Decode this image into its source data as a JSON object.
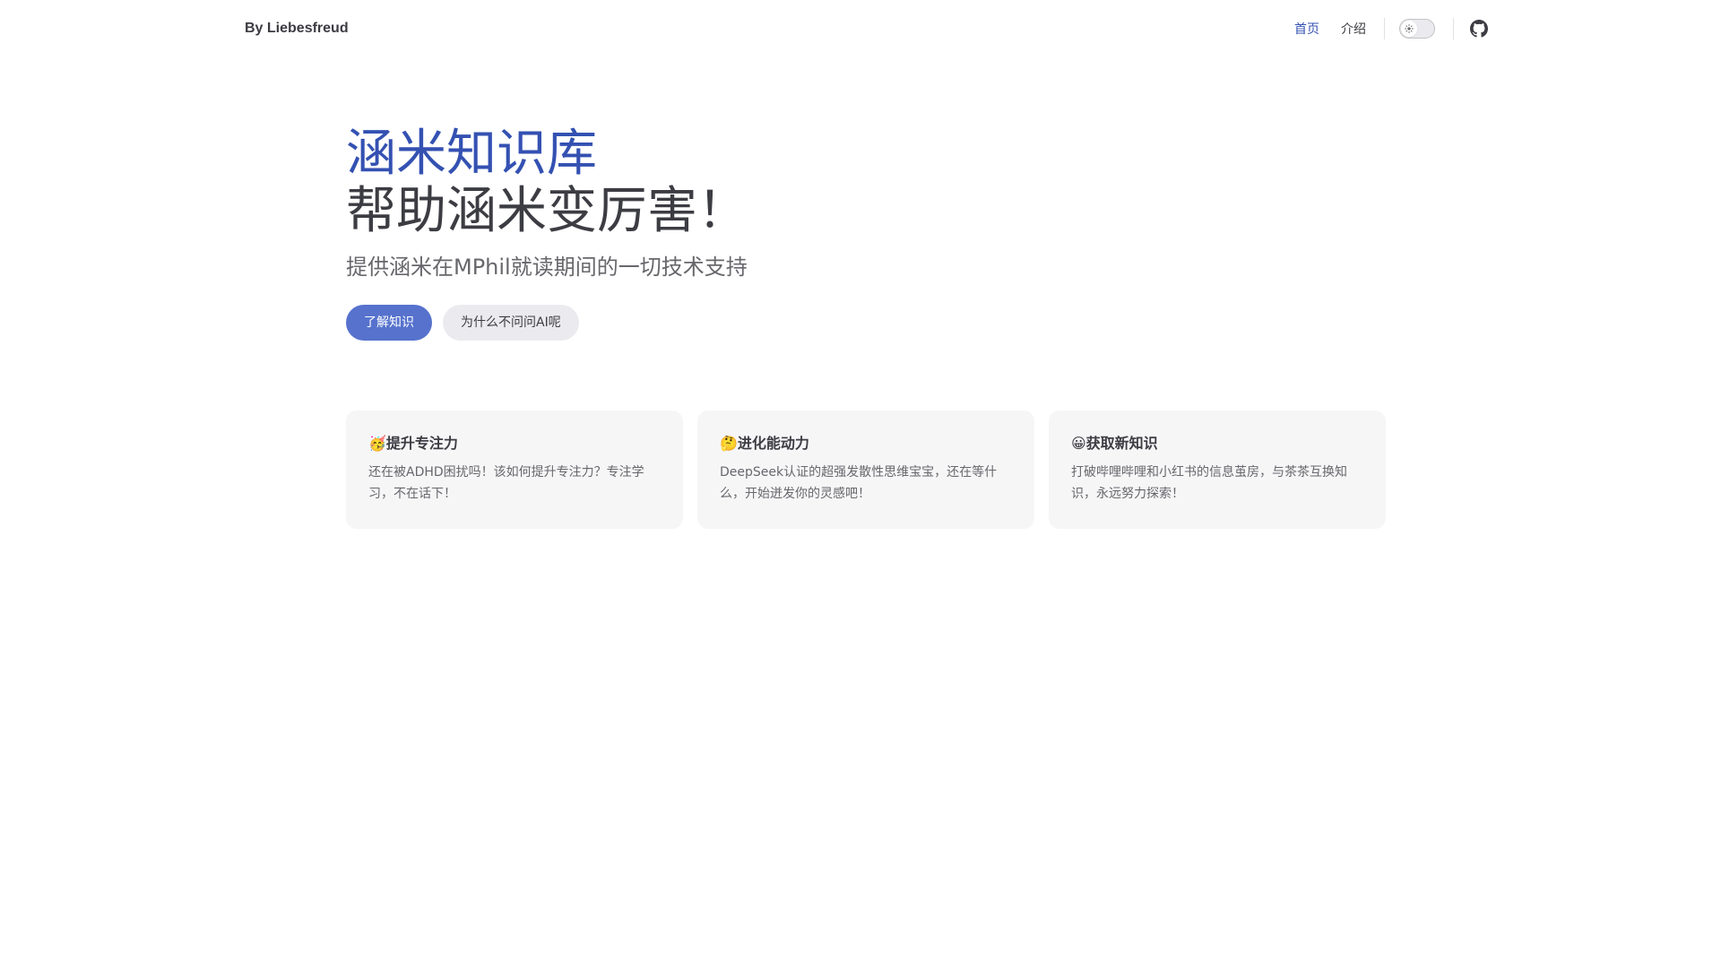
{
  "nav": {
    "site_title": "By Liebesfreud",
    "links": [
      {
        "label": "首页",
        "active": true
      },
      {
        "label": "介绍",
        "active": false
      }
    ],
    "appearance_toggle": {
      "state": "light",
      "icon": "sun-icon"
    },
    "github_icon": "github-icon"
  },
  "hero": {
    "name": "涵米知识库",
    "text": "帮助涵米变厉害！",
    "tagline": "提供涵米在MPhil就读期间的一切技术支持",
    "actions": [
      {
        "label": "了解知识",
        "theme": "brand"
      },
      {
        "label": "为什么不问问AI呢",
        "theme": "alt"
      }
    ]
  },
  "features": [
    {
      "title": "🥳提升专注力",
      "details": "还在被ADHD困扰吗！该如何提升专注力？专注学习，不在话下！"
    },
    {
      "title": "🤔进化能动力",
      "details": "DeepSeek认证的超强发散性思维宝宝，还在等什么，开始迸发你的灵感吧！"
    },
    {
      "title": "😀获取新知识",
      "details": "打破哔哩哔哩和小红书的信息茧房，与茶茶互换知识，永远努力探索！"
    }
  ],
  "colors": {
    "brand": "#3451b2",
    "brand_button": "#5672cd",
    "text": "#3c3c43",
    "muted_text": "#67676c",
    "card_bg": "#f6f6f7"
  }
}
